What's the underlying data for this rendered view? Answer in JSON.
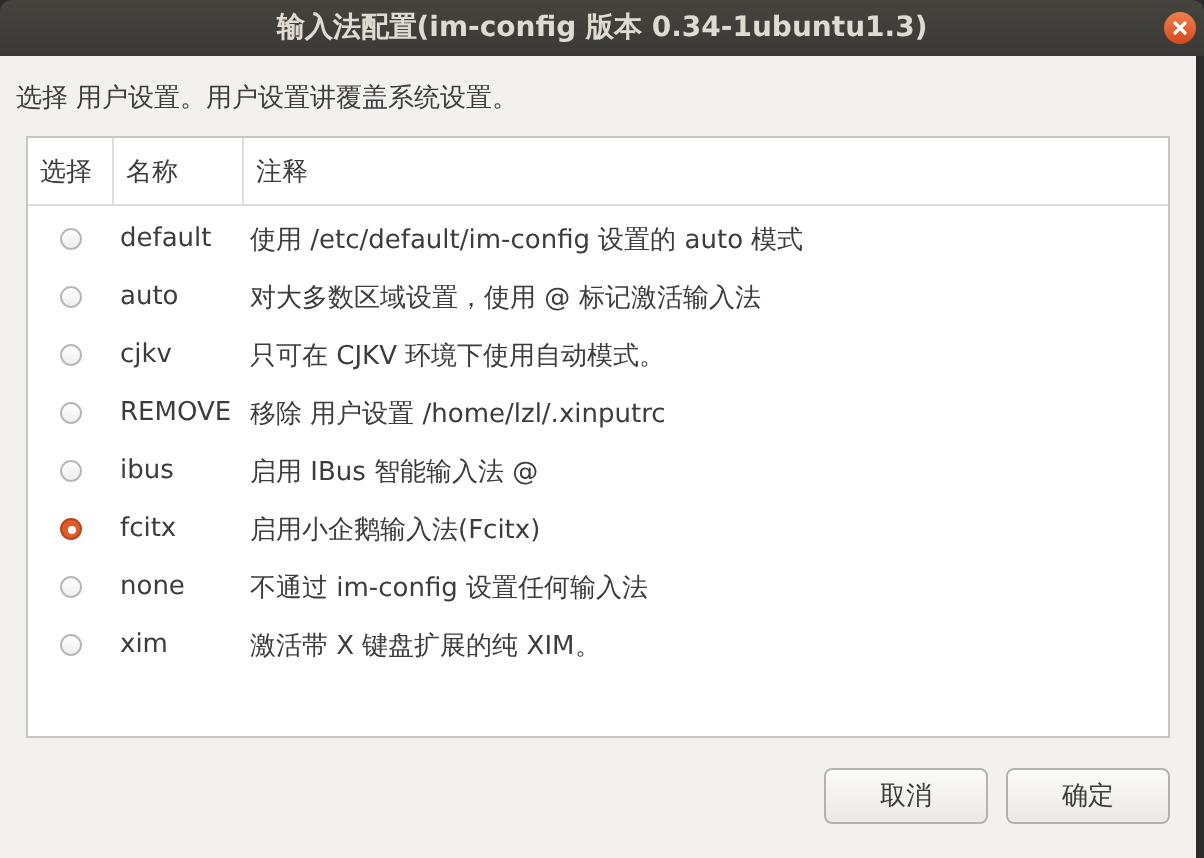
{
  "window": {
    "title": "输入法配置(im-config 版本 0.34-1ubuntu1.3)"
  },
  "instruction": "选择 用户设置。用户设置讲覆盖系统设置。",
  "table": {
    "columns": [
      "选择",
      "名称",
      "注释"
    ],
    "rows": [
      {
        "name": "default",
        "note": "使用 /etc/default/im-config 设置的 auto 模式",
        "selected": false
      },
      {
        "name": "auto",
        "note": "对大多数区域设置，使用 @ 标记激活输入法",
        "selected": false
      },
      {
        "name": "cjkv",
        "note": "只可在 CJKV 环境下使用自动模式。",
        "selected": false
      },
      {
        "name": "REMOVE",
        "note": "移除 用户设置 /home/lzl/.xinputrc",
        "selected": false
      },
      {
        "name": "ibus",
        "note": "启用 IBus 智能输入法 @",
        "selected": false
      },
      {
        "name": "fcitx",
        "note": "启用小企鹅输入法(Fcitx)",
        "selected": true
      },
      {
        "name": "none",
        "note": "不通过 im-config 设置任何输入法",
        "selected": false
      },
      {
        "name": "xim",
        "note": "激活带 X 键盘扩展的纯 XIM。",
        "selected": false
      }
    ]
  },
  "buttons": [
    "取消",
    "确定"
  ]
}
